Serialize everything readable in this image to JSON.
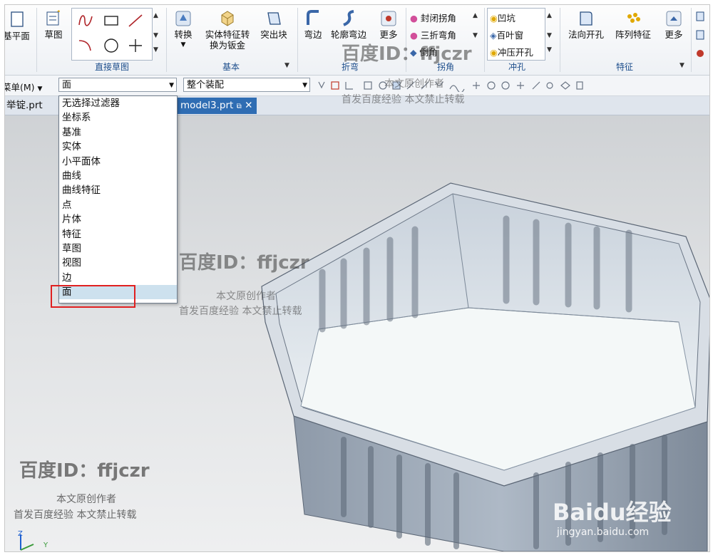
{
  "ribbon": {
    "partial_left_label": "基平面",
    "sketch_label": "草图",
    "direct_sketch_group": "直接草图",
    "convert_label": "转换",
    "solid_to_sheet_label_line1": "实体特征转",
    "solid_to_sheet_label_line2": "换为钣金",
    "tab_label": "突出块",
    "basic_group": "基本",
    "flange_label": "弯边",
    "contour_flange_label": "轮廓弯边",
    "more_label": "更多",
    "bend_group": "折弯",
    "closed_corner_label": "封闭拐角",
    "three_bend_corner_label": "三折弯角",
    "chamfer_label": "倒角",
    "corner_group": "拐角",
    "dimple_label": "凹坑",
    "louver_label": "百叶窗",
    "drawn_cutout_label": "冲压开孔",
    "punch_group": "冲孔",
    "normal_cutout_label": "法向开孔",
    "pattern_feature_label": "阵列特征",
    "more2_label": "更多",
    "feature_group": "特征"
  },
  "toolbar": {
    "menu_label": "菜单(M)",
    "filter_value": "面",
    "assembly_scope_value": "整个装配"
  },
  "tabs": [
    {
      "label": "举锭.prt"
    },
    {
      "label": "model3.prt"
    }
  ],
  "filter_options": [
    "无选择过滤器",
    "坐标系",
    "基准",
    "实体",
    "小平面体",
    "曲线",
    "曲线特征",
    "点",
    "片体",
    "特征",
    "草图",
    "视图",
    "边",
    "面"
  ],
  "selected_filter": "面",
  "watermarks": {
    "id_text": "百度ID：ffjczr",
    "original_text": "本文原创作者",
    "first_pub_text": "首发百度经验 本文禁止转载",
    "baidu_logo": "Baidu经验",
    "baidu_url": "jingyan.baidu.com"
  },
  "axis_labels": {
    "z": "Z",
    "y": "Y"
  },
  "colors": {
    "accent": "#2f6db3",
    "highlight_box": "#e02020",
    "selected_row": "#cde1ee",
    "part_color": "#9aa7b6"
  }
}
